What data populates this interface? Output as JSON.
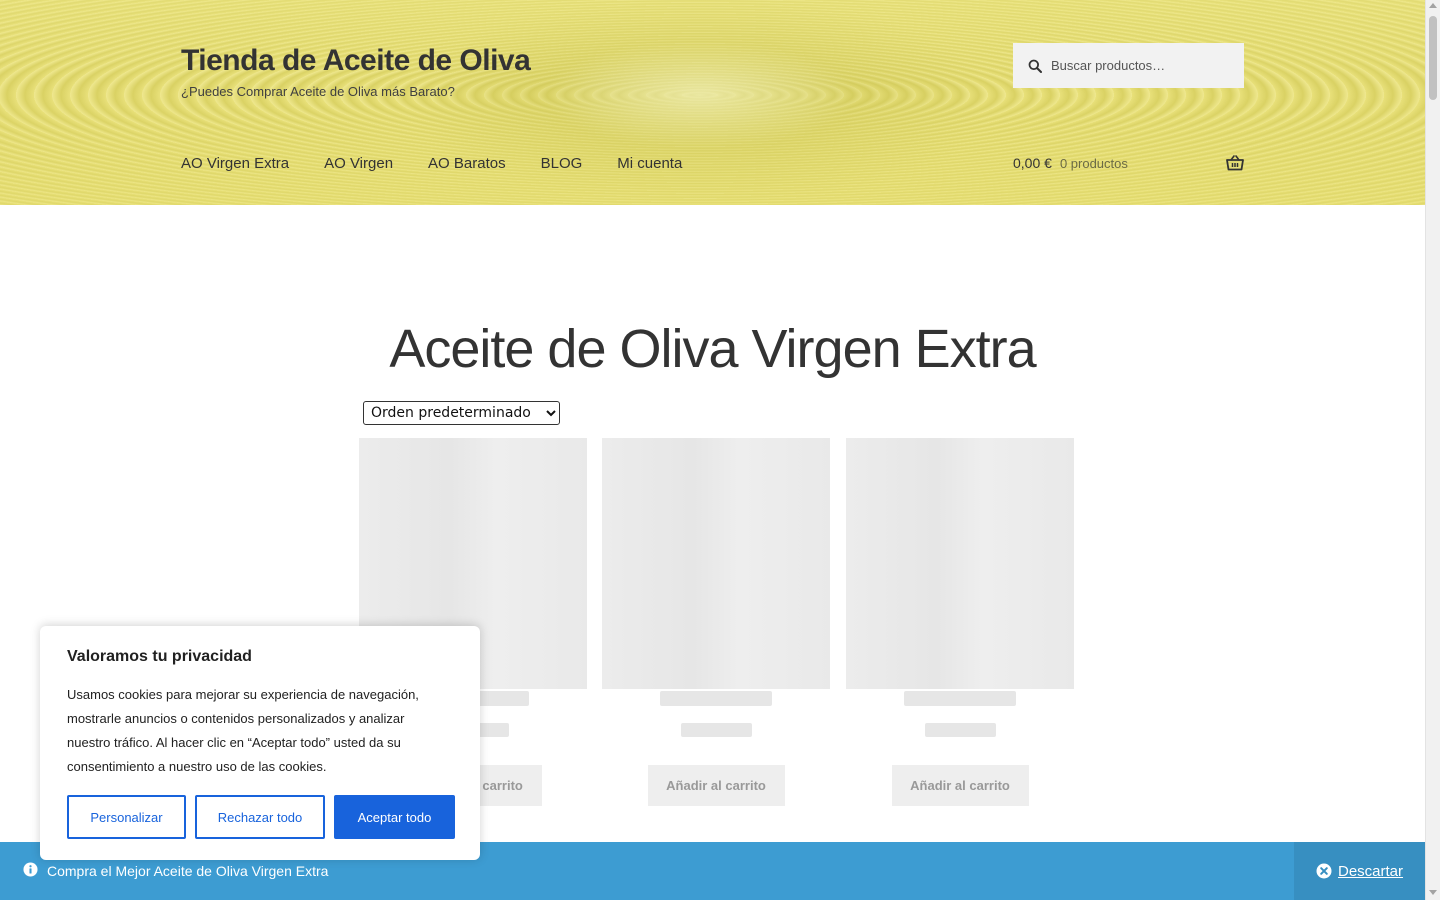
{
  "header": {
    "site_title": "Tienda de Aceite de Oliva",
    "tagline": "¿Puedes Comprar Aceite de Oliva más Barato?",
    "search_placeholder": "Buscar productos…",
    "nav": [
      "AO Virgen Extra",
      "AO Virgen",
      "AO Baratos",
      "BLOG",
      "Mi cuenta"
    ],
    "cart_amount": "0,00 €",
    "cart_count": "0 productos"
  },
  "main": {
    "page_title": "Aceite de Oliva Virgen Extra",
    "orderby_selected": "Orden predeterminado",
    "products": [
      {
        "button_label": "Añadir al carrito"
      },
      {
        "button_label": "Añadir al carrito"
      },
      {
        "button_label": "Añadir al carrito"
      }
    ]
  },
  "cookie_banner": {
    "title": "Valoramos tu privacidad",
    "text": "Usamos cookies para mejorar su experiencia de navegación, mostrarle anuncios o contenidos personalizados y analizar nuestro tráfico. Al hacer clic en “Aceptar todo” usted da su consentimiento a nuestro uso de las cookies.",
    "customize_label": "Personalizar",
    "reject_label": "Rechazar todo",
    "accept_label": "Aceptar todo"
  },
  "store_notice": {
    "message": "Compra el Mejor Aceite de Oliva Virgen Extra",
    "dismiss_label": "Descartar"
  },
  "colors": {
    "accent_blue": "#1863dc",
    "notice_blue": "#3d9cd2",
    "header_yellow": "#e3db72"
  },
  "icons": {
    "search": "search-icon",
    "cart": "basket-icon",
    "info": "info-icon",
    "dismiss": "close-circle-icon"
  }
}
